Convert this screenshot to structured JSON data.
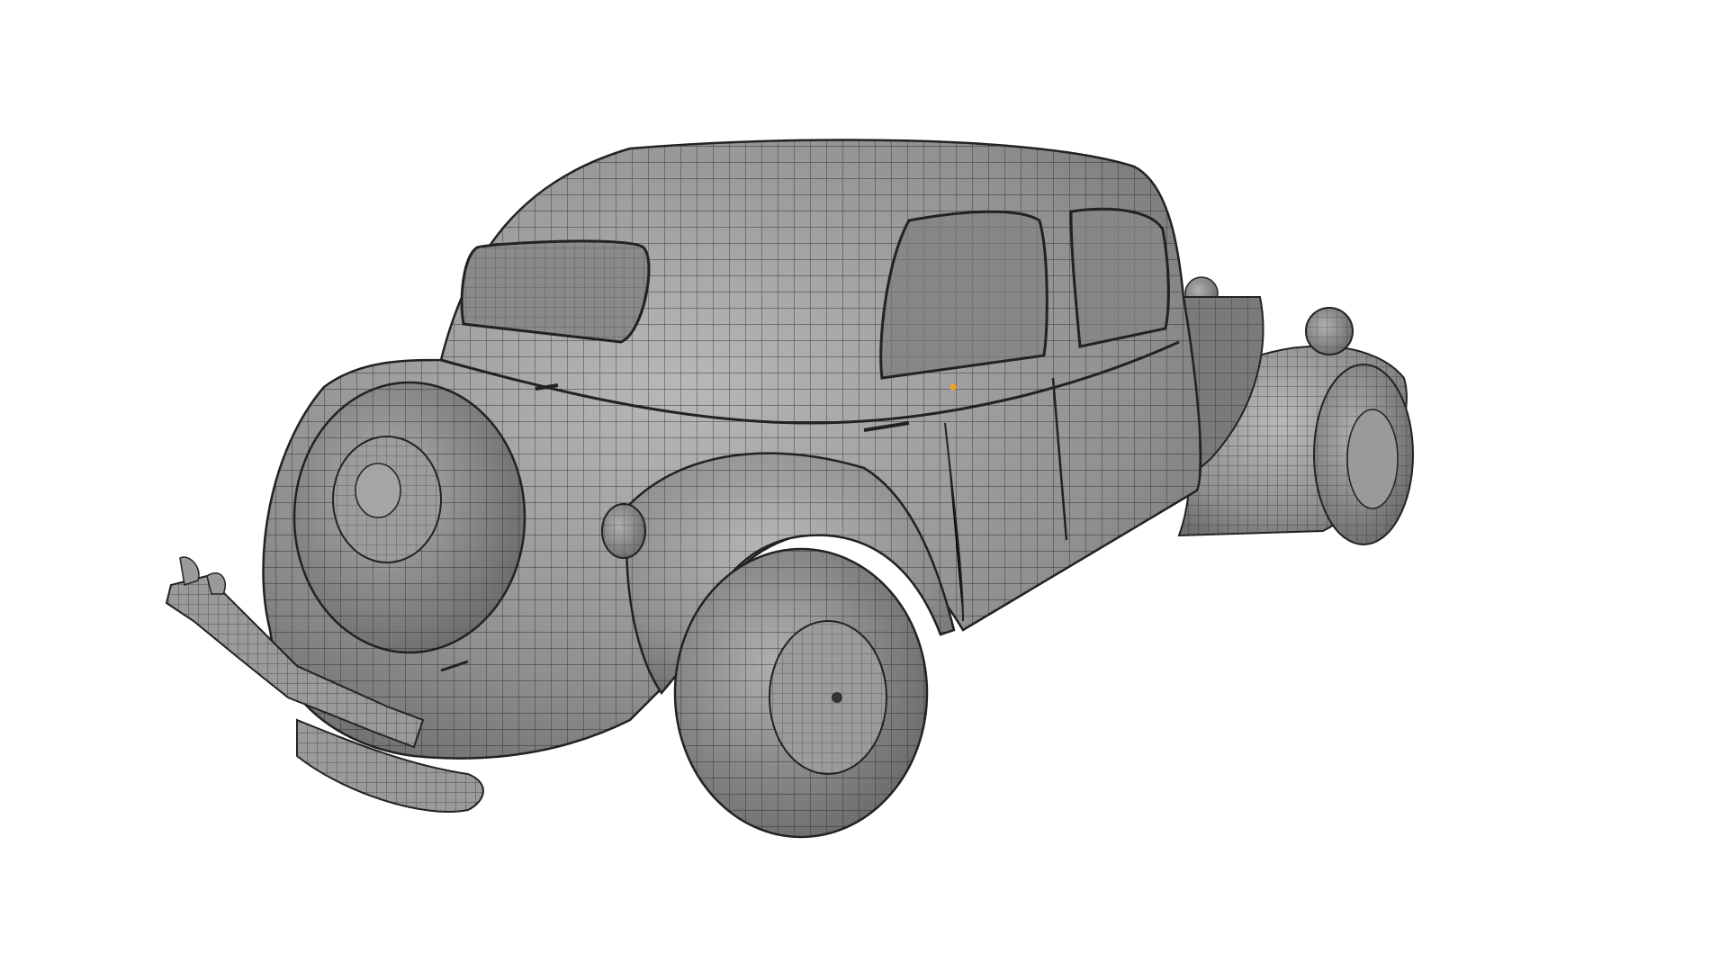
{
  "viewport": {
    "background": "#ffffff",
    "mesh_fill": "#8e8e8e",
    "mesh_fill_light": "#b4b4b4",
    "mesh_fill_dark": "#6a6a6a",
    "wire_color": "#1e1e1e",
    "highlight_vertex_color": "#f0a020"
  },
  "model": {
    "subject": "vintage-sedan-wireframe-mesh",
    "view": "rear-three-quarter"
  }
}
